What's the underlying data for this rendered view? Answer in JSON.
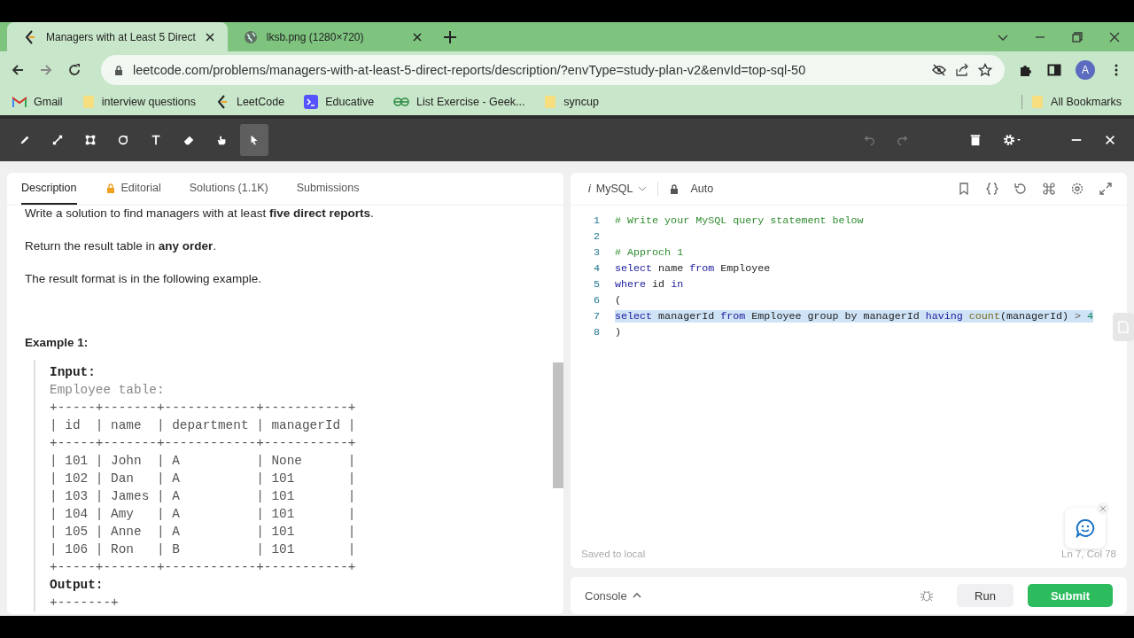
{
  "browser": {
    "tabs": [
      {
        "title": "Managers with at Least 5 Direct",
        "kind": "leetcode",
        "selected": true
      },
      {
        "title": "lksb.png (1280×720)",
        "kind": "globe",
        "selected": false
      }
    ],
    "url": "leetcode.com/problems/managers-with-at-least-5-direct-reports/description/?envType=study-plan-v2&envId=top-sql-50",
    "avatar": "A",
    "bookmarks": [
      {
        "label": "Gmail",
        "kind": "gmail"
      },
      {
        "label": "interview questions",
        "kind": "folder"
      },
      {
        "label": "LeetCode",
        "kind": "leetcode"
      },
      {
        "label": "Educative",
        "kind": "educative"
      },
      {
        "label": "List Exercise - Geek...",
        "kind": "gfg"
      },
      {
        "label": "syncup",
        "kind": "folder"
      }
    ],
    "all_bookmarks": "All Bookmarks"
  },
  "annotation_toolbar": {
    "tools": [
      {
        "kind": "pen",
        "selected": false
      },
      {
        "kind": "line",
        "selected": false
      },
      {
        "kind": "rect",
        "selected": false
      },
      {
        "kind": "circle",
        "selected": false
      },
      {
        "kind": "text",
        "selected": false
      },
      {
        "kind": "eraser",
        "selected": false
      },
      {
        "kind": "hand",
        "selected": false
      },
      {
        "kind": "pointer",
        "selected": true
      }
    ]
  },
  "description": {
    "tabs": [
      {
        "label": "Description",
        "locked": false,
        "selected": true
      },
      {
        "label": "Editorial",
        "locked": true,
        "selected": false
      },
      {
        "label": "Solutions (1.1K)",
        "locked": false,
        "selected": false
      },
      {
        "label": "Submissions",
        "locked": false,
        "selected": false
      }
    ],
    "paragraphs": [
      "Write a solution to find managers with at least **five direct reports**.",
      "Return the result table in **any order**.",
      "The result format is in the following example."
    ],
    "example_title": "Example 1:",
    "example_lines": [
      {
        "text": "Input:",
        "kind": "label"
      },
      {
        "text": "Employee table:",
        "kind": "caption"
      },
      {
        "text": "+-----+-------+------------+-----------+",
        "kind": "plain"
      },
      {
        "text": "| id  | name  | department | managerId |",
        "kind": "plain"
      },
      {
        "text": "+-----+-------+------------+-----------+",
        "kind": "plain"
      },
      {
        "text": "| 101 | John  | A          | None      |",
        "kind": "plain"
      },
      {
        "text": "| 102 | Dan   | A          | 101       |",
        "kind": "plain"
      },
      {
        "text": "| 103 | James | A          | 101       |",
        "kind": "plain"
      },
      {
        "text": "| 104 | Amy   | A          | 101       |",
        "kind": "plain"
      },
      {
        "text": "| 105 | Anne  | A          | 101       |",
        "kind": "plain"
      },
      {
        "text": "| 106 | Ron   | B          | 101       |",
        "kind": "plain"
      },
      {
        "text": "+-----+-------+------------+-----------+",
        "kind": "plain"
      },
      {
        "text": "Output:",
        "kind": "label"
      },
      {
        "text": "+-------+",
        "kind": "plain"
      }
    ]
  },
  "editor": {
    "language_icon": "i",
    "language": "MySQL",
    "mode": "Auto",
    "lines": [
      {
        "number": "1",
        "selected": false,
        "tokens": [
          {
            "text": "# Write your MySQL query statement below",
            "kind": "comment"
          }
        ]
      },
      {
        "number": "2",
        "selected": false
      },
      {
        "number": "3",
        "selected": false,
        "tokens": [
          {
            "text": "# Approch 1",
            "kind": "comment"
          }
        ]
      },
      {
        "number": "4",
        "selected": false,
        "tokens": [
          {
            "text": "select",
            "kind": "keyword"
          },
          {
            "text": " name ",
            "kind": "plain"
          },
          {
            "text": "from",
            "kind": "keyword"
          },
          {
            "text": " Employee",
            "kind": "plain"
          }
        ]
      },
      {
        "number": "5",
        "selected": false,
        "tokens": [
          {
            "text": "where",
            "kind": "keyword"
          },
          {
            "text": " id ",
            "kind": "plain"
          },
          {
            "text": "in",
            "kind": "keyword"
          }
        ]
      },
      {
        "number": "6",
        "selected": false,
        "tokens": [
          {
            "text": "(",
            "kind": "plain"
          }
        ]
      },
      {
        "number": "7",
        "selected": true,
        "tokens": [
          {
            "text": "select",
            "kind": "keyword"
          },
          {
            "text": " managerId ",
            "kind": "plain"
          },
          {
            "text": "from",
            "kind": "keyword"
          },
          {
            "text": " Employee group by managerId ",
            "kind": "plain"
          },
          {
            "text": "having",
            "kind": "keyword"
          },
          {
            "text": " count",
            "kind": "function"
          },
          {
            "text": "(managerId) ",
            "kind": "plain"
          },
          {
            "text": ">",
            "kind": "operator"
          },
          {
            "text": " 4",
            "kind": "number"
          }
        ]
      },
      {
        "number": "8",
        "selected": false,
        "tokens": [
          {
            "text": ")",
            "kind": "plain"
          }
        ]
      }
    ],
    "saved": "Saved to local",
    "cursor": "Ln 7, Col 78"
  },
  "console": {
    "label": "Console",
    "run": "Run",
    "submit": "Submit"
  }
}
